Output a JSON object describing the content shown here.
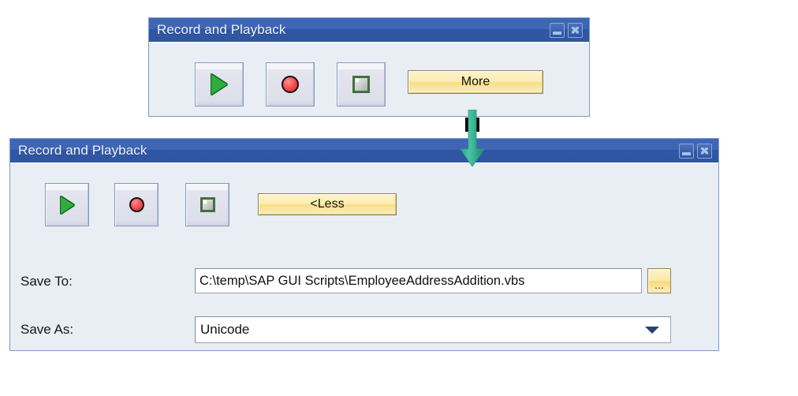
{
  "windows": [
    {
      "id": "collapsed",
      "title": "Record and Playback",
      "titlebar_color": "#3f66b5",
      "panel_color": "#e9eef5",
      "buttons": {
        "play": "play-icon",
        "record": "record-icon",
        "stop": "stop-icon",
        "expand_label": "More"
      },
      "window_controls": {
        "minimize": "minimize-icon",
        "close": "close-icon"
      }
    },
    {
      "id": "expanded",
      "title": "Record and Playback",
      "titlebar_color": "#3f66b5",
      "panel_color": "#e9eef5",
      "buttons": {
        "play": "play-icon",
        "record": "record-icon",
        "stop": "stop-icon",
        "collapse_label": "<Less"
      },
      "window_controls": {
        "minimize": "minimize-icon",
        "close": "close-icon"
      },
      "form": {
        "save_to_label": "Save To:",
        "save_to_value": "C:\\temp\\SAP GUI Scripts\\EmployeeAddressAddition.vbs",
        "browse_label": "...",
        "save_as_label": "Save As:",
        "save_as_value": "Unicode",
        "save_as_options": [
          "Unicode"
        ]
      }
    }
  ],
  "annotation": {
    "arrow": "down-arrow-annotation",
    "color": "#3ab795"
  }
}
